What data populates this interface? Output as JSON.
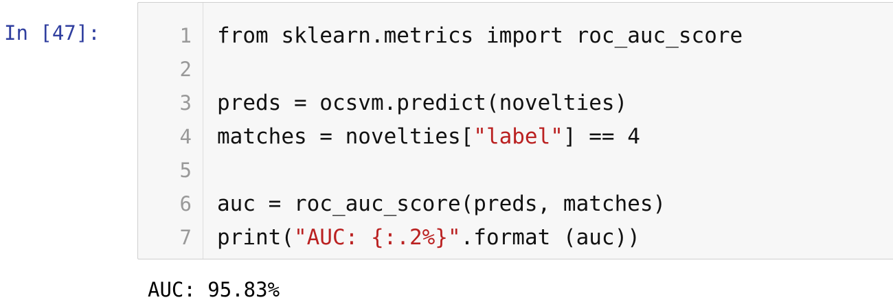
{
  "cell": {
    "prompt": "In [47]:",
    "line_numbers": [
      "1",
      "2",
      "3",
      "4",
      "5",
      "6",
      "7"
    ],
    "code_lines": [
      {
        "segments": [
          {
            "text": "from sklearn.metrics import roc_auc_score",
            "kind": "code"
          }
        ]
      },
      {
        "segments": [
          {
            "text": "",
            "kind": "code"
          }
        ]
      },
      {
        "segments": [
          {
            "text": "preds = ocsvm.predict(novelties)",
            "kind": "code"
          }
        ]
      },
      {
        "segments": [
          {
            "text": "matches = novelties[",
            "kind": "code"
          },
          {
            "text": "\"label\"",
            "kind": "string"
          },
          {
            "text": "] == 4",
            "kind": "code"
          }
        ]
      },
      {
        "segments": [
          {
            "text": "",
            "kind": "code"
          }
        ]
      },
      {
        "segments": [
          {
            "text": "auc = roc_auc_score(preds, matches)",
            "kind": "code"
          }
        ]
      },
      {
        "segments": [
          {
            "text": "print(",
            "kind": "code"
          },
          {
            "text": "\"AUC: {:.2%}\"",
            "kind": "string"
          },
          {
            "text": ".format (auc))",
            "kind": "code"
          }
        ]
      }
    ],
    "output": "AUC: 95.83%"
  },
  "colors": {
    "prompt": "#303f9f",
    "string": "#ba2121",
    "line_number": "#999999",
    "cell_background": "#f7f7f7",
    "cell_border": "#cfcfcf"
  }
}
